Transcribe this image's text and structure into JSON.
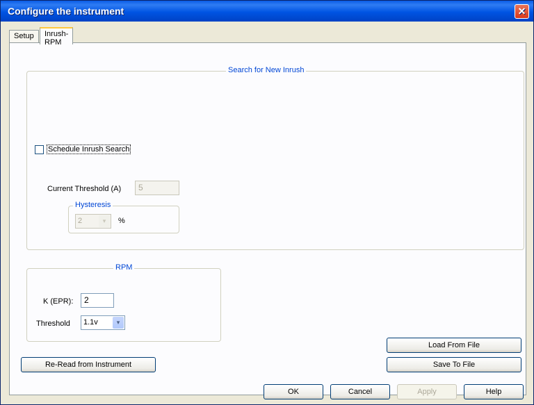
{
  "window": {
    "title": "Configure the instrument",
    "close_glyph": "✕"
  },
  "tabs": [
    {
      "label": "Setup",
      "active": false
    },
    {
      "label": "Inrush-RPM",
      "active": true
    }
  ],
  "inrush": {
    "group_title": "Search for New Inrush",
    "schedule_label": "Schedule Inrush Search",
    "schedule_checked": false,
    "current_threshold_label": "Current Threshold (A)",
    "current_threshold_value": "5",
    "hysteresis_title": "Hysteresis",
    "hysteresis_value": "2",
    "hysteresis_unit": "%"
  },
  "rpm": {
    "group_title": "RPM",
    "k_label": "K (EPR):",
    "k_value": "2",
    "threshold_label": "Threshold",
    "threshold_value": "1.1v"
  },
  "buttons": {
    "load_from_file": "Load From File",
    "save_to_file": "Save To File",
    "reread": "Re-Read from Instrument",
    "ok": "OK",
    "cancel": "Cancel",
    "apply": "Apply",
    "help": "Help"
  },
  "icons": {
    "dropdown": "▾"
  },
  "colors": {
    "titlebar": "#0054e3",
    "group_title": "#0046d5",
    "active_tab_highlight": "#ffc83c"
  }
}
